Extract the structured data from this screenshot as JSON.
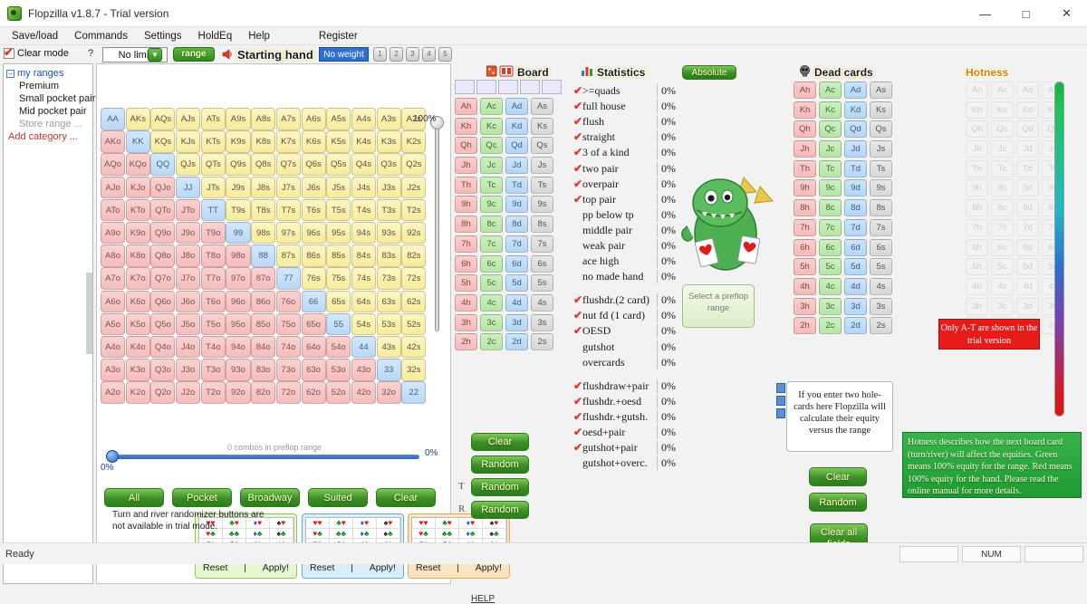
{
  "window": {
    "title": "Flopzilla v1.8.7 - Trial version",
    "minimize": "—",
    "maximize": "□",
    "close": "✕"
  },
  "menu": {
    "items": [
      "Save/load",
      "Commands",
      "Settings",
      "HoldEq",
      "Help"
    ],
    "register": "Register"
  },
  "toolbar": {
    "clear_mode_label": "Clear mode",
    "help_mark": "?",
    "limit_value": "No limit",
    "range_button": "range",
    "starting_hand_title": "Starting hand",
    "no_weight_label": "No weight",
    "weight_buttons": [
      "1",
      "2",
      "3",
      "4",
      "5"
    ],
    "slider_pct": "100%"
  },
  "sidebar": {
    "root": "my ranges",
    "toggle": "−",
    "items": [
      "Premium",
      "Small pocket pair",
      "Mid pocket pair"
    ],
    "store_range": "Store range ...",
    "add_category": "Add category ..."
  },
  "matrix": {
    "combos_label": "0 combos in preflop range",
    "slider_right_pct": "0%",
    "slider_left_pct": "0%",
    "rows": [
      [
        "AA",
        "AKs",
        "AQs",
        "AJs",
        "ATs",
        "A9s",
        "A8s",
        "A7s",
        "A6s",
        "A5s",
        "A4s",
        "A3s",
        "A2s"
      ],
      [
        "AKo",
        "KK",
        "KQs",
        "KJs",
        "KTs",
        "K9s",
        "K8s",
        "K7s",
        "K6s",
        "K5s",
        "K4s",
        "K3s",
        "K2s"
      ],
      [
        "AQo",
        "KQo",
        "QQ",
        "QJs",
        "QTs",
        "Q9s",
        "Q8s",
        "Q7s",
        "Q6s",
        "Q5s",
        "Q4s",
        "Q3s",
        "Q2s"
      ],
      [
        "AJo",
        "KJo",
        "QJo",
        "JJ",
        "JTs",
        "J9s",
        "J8s",
        "J7s",
        "J6s",
        "J5s",
        "J4s",
        "J3s",
        "J2s"
      ],
      [
        "ATo",
        "KTo",
        "QTo",
        "JTo",
        "TT",
        "T9s",
        "T8s",
        "T7s",
        "T6s",
        "T5s",
        "T4s",
        "T3s",
        "T2s"
      ],
      [
        "A9o",
        "K9o",
        "Q9o",
        "J9o",
        "T9o",
        "99",
        "98s",
        "97s",
        "96s",
        "95s",
        "94s",
        "93s",
        "92s"
      ],
      [
        "A8o",
        "K8o",
        "Q8o",
        "J8o",
        "T8o",
        "98o",
        "88",
        "87s",
        "86s",
        "85s",
        "84s",
        "83s",
        "82s"
      ],
      [
        "A7o",
        "K7o",
        "Q7o",
        "J7o",
        "T7o",
        "97o",
        "87o",
        "77",
        "76s",
        "75s",
        "74s",
        "73s",
        "72s"
      ],
      [
        "A6o",
        "K6o",
        "Q6o",
        "J6o",
        "T6o",
        "96o",
        "86o",
        "76o",
        "66",
        "65s",
        "64s",
        "63s",
        "62s"
      ],
      [
        "A5o",
        "K5o",
        "Q5o",
        "J5o",
        "T5o",
        "95o",
        "85o",
        "75o",
        "65o",
        "55",
        "54s",
        "53s",
        "52s"
      ],
      [
        "A4o",
        "K4o",
        "Q4o",
        "J4o",
        "T4o",
        "94o",
        "84o",
        "74o",
        "64o",
        "54o",
        "44",
        "43s",
        "42s"
      ],
      [
        "A3o",
        "K3o",
        "Q3o",
        "J3o",
        "T3o",
        "93o",
        "83o",
        "73o",
        "63o",
        "53o",
        "43o",
        "33",
        "32s"
      ],
      [
        "A2o",
        "K2o",
        "Q2o",
        "J2o",
        "T2o",
        "92o",
        "82o",
        "72o",
        "62o",
        "52o",
        "42o",
        "32o",
        "22"
      ]
    ]
  },
  "quick_buttons": [
    "All",
    "Pocket",
    "Broadway",
    "Suited",
    "Clear"
  ],
  "suit_selectors": {
    "reset_label": "Reset",
    "separator": "|",
    "apply_label": "Apply!",
    "rows": [
      [
        "h h",
        "c h",
        "d h",
        "s h"
      ],
      [
        "h c",
        "c c",
        "d c",
        "s c"
      ],
      [
        "h d",
        "c d",
        "d d",
        "s d"
      ],
      [
        "h s",
        "c s",
        "d s",
        "s s"
      ]
    ]
  },
  "help_link": "HELP",
  "board": {
    "title": "Board",
    "slot_count": 5,
    "ranks": [
      "A",
      "K",
      "Q",
      "J",
      "T",
      "9",
      "8",
      "7",
      "6",
      "5",
      "4",
      "3",
      "2"
    ],
    "suits": [
      "h",
      "c",
      "d",
      "s"
    ],
    "buttons": [
      "Clear",
      "Random",
      "Random",
      "Random"
    ],
    "turn_label": "T",
    "river_label": "R",
    "trial_note": "Turn and river randomizer buttons are not available in trial mode."
  },
  "statistics": {
    "title": "Statistics",
    "absolute_button": "Absolute",
    "group1": [
      {
        "name": ">=quads",
        "value": "0%",
        "checked": true
      },
      {
        "name": "full house",
        "value": "0%",
        "checked": true
      },
      {
        "name": "flush",
        "value": "0%",
        "checked": true
      },
      {
        "name": "straight",
        "value": "0%",
        "checked": true
      },
      {
        "name": "3 of a kind",
        "value": "0%",
        "checked": true
      },
      {
        "name": "two pair",
        "value": "0%",
        "checked": true
      },
      {
        "name": "overpair",
        "value": "0%",
        "checked": true
      },
      {
        "name": "top pair",
        "value": "0%",
        "checked": true
      },
      {
        "name": "pp below tp",
        "value": "0%",
        "checked": false
      },
      {
        "name": "middle pair",
        "value": "0%",
        "checked": false
      },
      {
        "name": "weak pair",
        "value": "0%",
        "checked": false
      },
      {
        "name": "ace high",
        "value": "0%",
        "checked": false
      },
      {
        "name": "no made hand",
        "value": "0%",
        "checked": false
      }
    ],
    "group2": [
      {
        "name": "flushdr.(2 card)",
        "value": "0%",
        "checked": true
      },
      {
        "name": "nut fd (1 card)",
        "value": "0%",
        "checked": true
      },
      {
        "name": "OESD",
        "value": "0%",
        "checked": true
      },
      {
        "name": "gutshot",
        "value": "0%",
        "checked": false
      },
      {
        "name": "overcards",
        "value": "0%",
        "checked": false
      }
    ],
    "group3": [
      {
        "name": "flushdraw+pair",
        "value": "0%",
        "checked": true
      },
      {
        "name": "flushdr.+oesd",
        "value": "0%",
        "checked": true
      },
      {
        "name": "flushdr.+gutsh.",
        "value": "0%",
        "checked": true
      },
      {
        "name": "oesd+pair",
        "value": "0%",
        "checked": true
      },
      {
        "name": "gutshot+pair",
        "value": "0%",
        "checked": true
      },
      {
        "name": "gutshot+overc.",
        "value": "0%",
        "checked": false
      }
    ],
    "preflop_button": "Select a preflop range"
  },
  "dead_cards": {
    "title": "Dead cards",
    "ranks": [
      "A",
      "K",
      "Q",
      "J",
      "T",
      "9",
      "8",
      "7",
      "6",
      "5",
      "4",
      "3",
      "2"
    ],
    "suits": [
      "h",
      "c",
      "d",
      "s"
    ],
    "hole_tip": "If you enter two hole-cards here Flopzilla will calculate their equity versus the range",
    "buttons": [
      "Clear",
      "Random"
    ],
    "clear_all": "Clear all fields"
  },
  "hotness": {
    "title": "Hotness",
    "ranks": [
      "A",
      "K",
      "Q",
      "J",
      "T",
      "9",
      "8",
      "7",
      "6",
      "5",
      "4",
      "3",
      "2"
    ],
    "suits": [
      "h",
      "c",
      "d",
      "s"
    ],
    "trial_banner": "Only A-T are shown in the trial version",
    "description": "Hotness describes how the next board card (turn/river) will affect the equities. Green means 100% equity for the range. Red means 100% equity for the hand. Please read the online manual for more details."
  },
  "statusbar": {
    "text": "Ready",
    "num_label": "NUM",
    "fields": [
      "",
      "NUM",
      ""
    ]
  },
  "colors": {
    "accent_green": "#2f8a22",
    "warning_red": "#e81b1b",
    "pair_blue": "#b9d8f7",
    "suited_yellow": "#f7eb9a",
    "offsuit_red": "#f6bcbc"
  }
}
